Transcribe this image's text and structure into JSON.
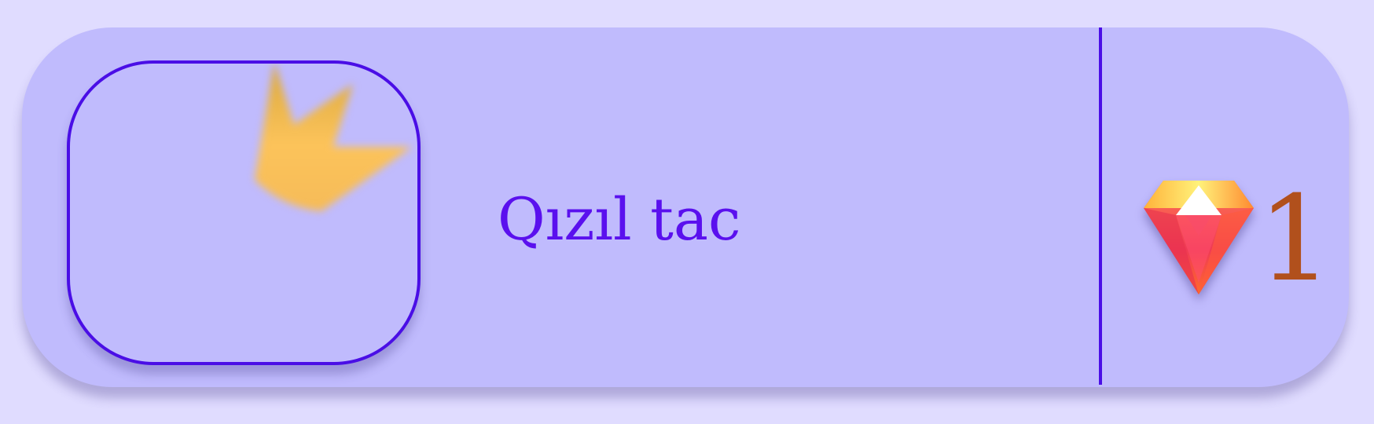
{
  "item": {
    "name": "Qızıl tac",
    "icon": "crown-icon",
    "icon_color": "#fcc35a"
  },
  "cost": {
    "icon": "gem-icon",
    "amount": "1",
    "amount_color": "#b1501c"
  },
  "colors": {
    "background": "#e0dcff",
    "card": "#c0bbfd",
    "accent": "#4a0ee6",
    "name_text": "#5a10ee"
  }
}
